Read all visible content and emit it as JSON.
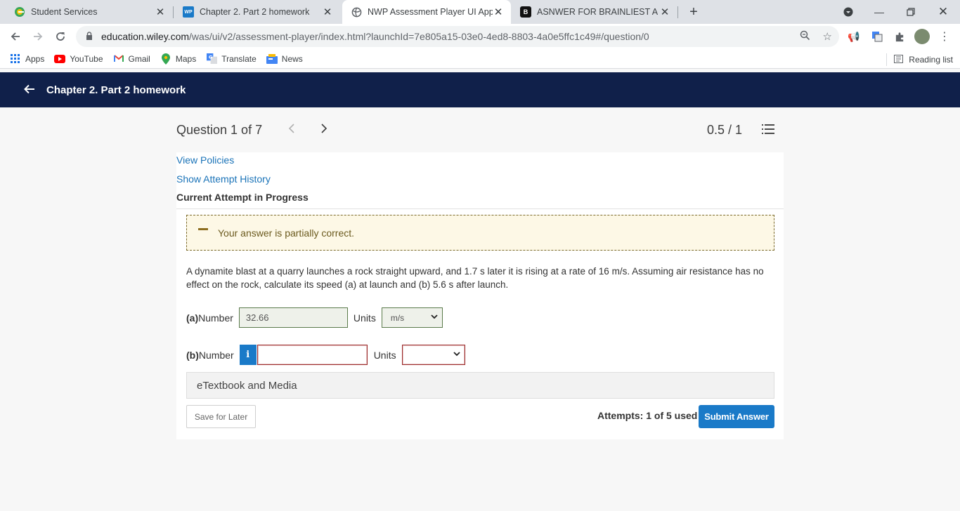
{
  "browser": {
    "tabs": [
      {
        "title": "Student Services",
        "favicon": "edge-e-icon"
      },
      {
        "title": "Chapter 2. Part 2 homework",
        "favicon_text": "WP"
      },
      {
        "title": "NWP Assessment Player UI Appli",
        "favicon": "globe-icon"
      },
      {
        "title": "ASNWER FOR BRAINLIEST A bus",
        "favicon_text": "B"
      }
    ],
    "url_host": "education.wiley.com",
    "url_path": "/was/ui/v2/assessment-player/index.html?launchId=7e805a15-03e0-4ed8-8803-4a0e5ffc1c49#/question/0",
    "bookmarks": [
      "Apps",
      "YouTube",
      "Gmail",
      "Maps",
      "Translate",
      "News"
    ],
    "reading_list": "Reading list"
  },
  "app": {
    "title": "Chapter 2. Part 2 homework"
  },
  "question_header": {
    "counter": "Question 1 of 7",
    "score": "0.5 / 1"
  },
  "content": {
    "view_policies": "View Policies",
    "show_attempt_history": "Show Attempt History",
    "current_attempt": "Current Attempt in Progress",
    "feedback": "Your answer is partially correct.",
    "question_text": "A dynamite blast at a quarry launches a rock straight upward, and 1.7 s later it is rising at a rate of 16 m/s. Assuming air resistance has no effect on the rock, calculate its speed (a) at launch and (b) 5.6 s after launch.",
    "part_a": {
      "label_letter": "(a)",
      "label": "Number",
      "value": "32.66",
      "units_label": "Units",
      "units_value": "m/s"
    },
    "part_b": {
      "label_letter": "(b)",
      "label": "Number",
      "value": "",
      "units_label": "Units",
      "units_value": "",
      "info": "i"
    },
    "etextbook": "eTextbook and Media",
    "save_later": "Save for Later",
    "attempts": "Attempts: 1 of 5 used",
    "submit": "Submit Answer"
  },
  "colors": {
    "appbar": "#10204a",
    "link": "#1a73b8",
    "primary_button": "#1a7ac8",
    "partial_bg": "#fdf8e6",
    "error_border": "#9b2a2a"
  }
}
